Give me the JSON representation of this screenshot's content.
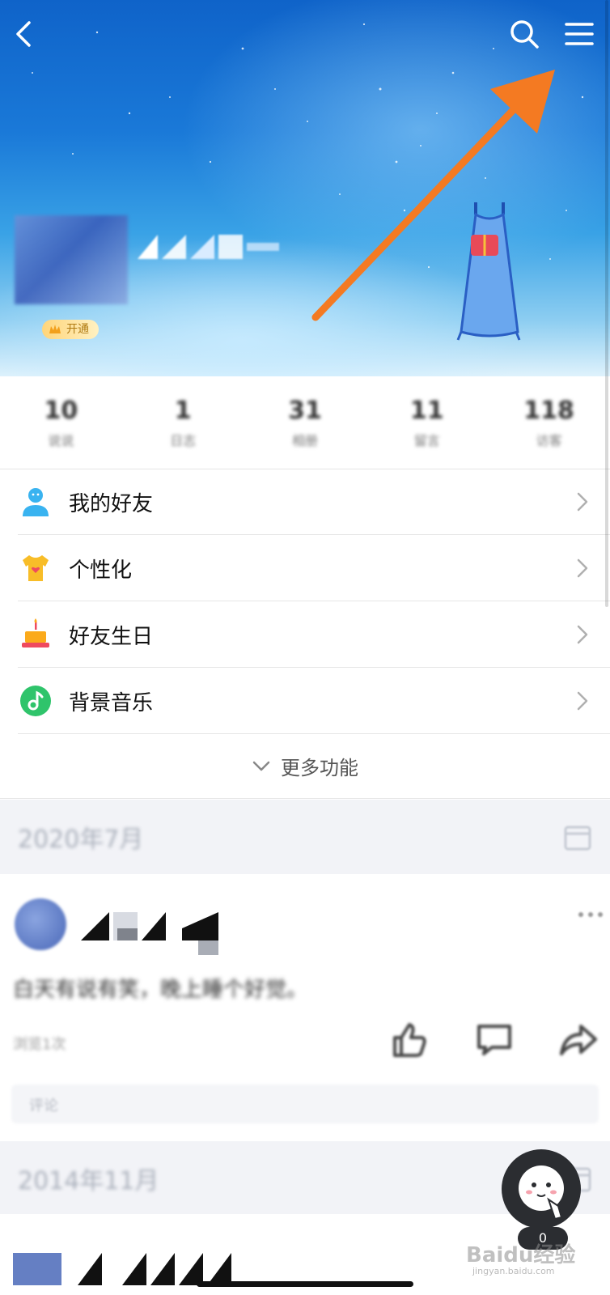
{
  "profile": {
    "vip_label": "开通",
    "stats": [
      {
        "value": "10",
        "label": "说说"
      },
      {
        "value": "1",
        "label": "日志"
      },
      {
        "value": "31",
        "label": "相册"
      },
      {
        "value": "11",
        "label": "留言"
      },
      {
        "value": "118",
        "label": "访客"
      }
    ]
  },
  "menu": {
    "items": [
      {
        "label": "我的好友",
        "icon": "friends-icon",
        "color": "#39b3f0"
      },
      {
        "label": "个性化",
        "icon": "shirt-icon",
        "color": "#f8bd28"
      },
      {
        "label": "好友生日",
        "icon": "cake-icon",
        "color": "#fbaa1b"
      },
      {
        "label": "背景音乐",
        "icon": "music-icon",
        "color": "#2fc46b"
      }
    ],
    "more_label": "更多功能"
  },
  "feed": {
    "date_1": "2020年7月",
    "post_text": "白天有说有笑，晚上睡个好觉。",
    "post_meta": "浏览1次",
    "comment_placeholder": "评论",
    "date_2": "2014年11月"
  },
  "assistant": {
    "count": "0"
  },
  "watermark": {
    "main": "Baidu经验",
    "sub": "jingyan.baidu.com"
  },
  "colors": {
    "accent_arrow": "#f47a22",
    "banner_top": "#0f63c9",
    "feed_bg": "#f2f3f7"
  }
}
